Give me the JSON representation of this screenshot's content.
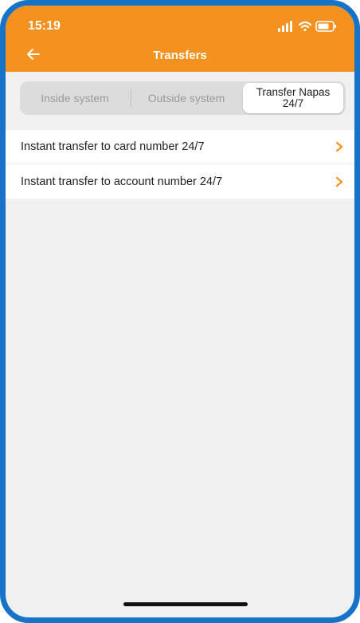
{
  "status_bar": {
    "time": "15:19"
  },
  "header": {
    "title": "Transfers",
    "back_icon": "arrow-left-icon"
  },
  "tabs": [
    {
      "label": "Inside system",
      "selected": false
    },
    {
      "label": "Outside system",
      "selected": false
    },
    {
      "label": "Transfer Napas 24/7",
      "selected": true
    }
  ],
  "list": {
    "items": [
      {
        "label": "Instant transfer to card number 24/7",
        "icon": "chevron-right-icon"
      },
      {
        "label": "Instant transfer to account number 24/7",
        "icon": "chevron-right-icon"
      }
    ]
  },
  "colors": {
    "accent": "#f5921f",
    "frame": "#1673c7",
    "background": "#f0f0f0"
  }
}
